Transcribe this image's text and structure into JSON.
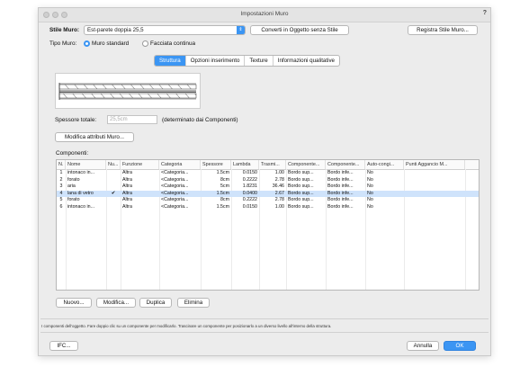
{
  "window": {
    "title": "Impostazioni Muro",
    "help": "?"
  },
  "stile": {
    "label": "Stile Muro:",
    "value": "Est-parete doppia 25,5",
    "convert_button": "Converti in Oggetto senza Stile",
    "register_button": "Registra Stile Muro..."
  },
  "tipo": {
    "label": "Tipo Muro:",
    "option1": "Muro standard",
    "option2": "Facciata continua",
    "selected": "Muro standard"
  },
  "tabs": [
    "Struttura",
    "Opzioni inserimento",
    "Texture",
    "Informazioni qualitative"
  ],
  "active_tab": "Struttura",
  "spessore": {
    "label": "Spessore totale:",
    "value": "25,5cm",
    "note": "(determinato dai Componenti)"
  },
  "modifica_attributi": "Modifica attributi Muro...",
  "componenti": {
    "label": "Componenti:",
    "columns": [
      "N.",
      "Nome",
      "Nu...",
      "Funzione",
      "Categoria",
      "Spessore",
      "Lambda",
      "Trasmi...",
      "Componente...",
      "Componente...",
      "Auto-congi...",
      "Punti Aggancio M..."
    ],
    "rows": [
      [
        "1",
        "intonaco in...",
        "",
        "Altra",
        "<Categoria...",
        "1.5cm",
        "0.0150",
        "1.00",
        "Bordo sup...",
        "Bordo infe...",
        "No",
        ""
      ],
      [
        "2",
        "forato",
        "",
        "Altra",
        "<Categoria...",
        "8cm",
        "0.2222",
        "2.78",
        "Bordo sup...",
        "Bordo infe...",
        "No",
        ""
      ],
      [
        "3",
        "aria",
        "",
        "Altra",
        "<Categoria...",
        "5cm",
        "1.8231",
        "36.46",
        "Bordo sup...",
        "Bordo infe...",
        "No",
        ""
      ],
      [
        "4",
        "lana di vetro",
        "✔",
        "Altra",
        "<Categoria...",
        "1.5cm",
        "0.0400",
        "2.67",
        "Bordo sup...",
        "Bordo infe...",
        "No",
        ""
      ],
      [
        "5",
        "forato",
        "",
        "Altra",
        "<Categoria...",
        "8cm",
        "0.2222",
        "2.78",
        "Bordo sup...",
        "Bordo infe...",
        "No",
        ""
      ],
      [
        "6",
        "intonaco in...",
        "",
        "Altra",
        "<Categoria...",
        "1.5cm",
        "0.0150",
        "1.00",
        "Bordo sup...",
        "Bordo infe...",
        "No",
        ""
      ]
    ],
    "selected_row": 3
  },
  "buttons": {
    "nuovo": "Nuovo...",
    "modifica": "Modifica...",
    "duplica": "Duplica",
    "elimina": "Elimina"
  },
  "footer_note": "I componenti dell'oggetto. Fare doppio clic su un componente per modificarlo. Trascinare un componente per posizionarlo a un diverso livello all'interno della struttura.",
  "bottom": {
    "ifc": "IFC...",
    "annulla": "Annulla",
    "ok": "OK"
  },
  "colors": {
    "accent": "#3b95f3",
    "selection": "#cfe3fb",
    "window_bg": "#ececec"
  }
}
